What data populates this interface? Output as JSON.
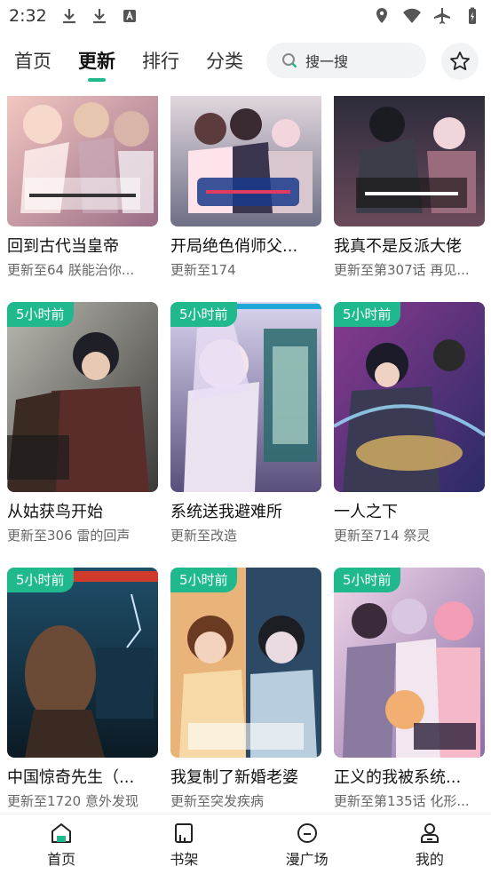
{
  "status_bar": {
    "time": "2:32"
  },
  "tabs": [
    {
      "label": "首页"
    },
    {
      "label": "更新"
    },
    {
      "label": "排行"
    },
    {
      "label": "分类"
    }
  ],
  "search": {
    "placeholder": "搜一搜"
  },
  "accent": "#1fb98d",
  "cards": [
    {
      "title": "回到古代当皇帝",
      "sub": "更新至64 朕能治你...",
      "badge": ""
    },
    {
      "title": "开局绝色俏师父...",
      "sub": "更新至174",
      "badge": ""
    },
    {
      "title": "我真不是反派大佬",
      "sub": "更新至第307话 再见...",
      "badge": ""
    },
    {
      "title": "从姑获鸟开始",
      "sub": "更新至306 雷的回声",
      "badge": "5小时前"
    },
    {
      "title": "系统送我避难所",
      "sub": "更新至改造",
      "badge": "5小时前"
    },
    {
      "title": "一人之下",
      "sub": "更新至714 祭灵",
      "badge": "5小时前"
    },
    {
      "title": "中国惊奇先生（...",
      "sub": "更新至1720 意外发现",
      "badge": "5小时前"
    },
    {
      "title": "我复制了新婚老婆",
      "sub": "更新至突发疾病",
      "badge": "5小时前"
    },
    {
      "title": "正义的我被系统...",
      "sub": "更新至第135话 化形...",
      "badge": "5小时前"
    }
  ],
  "bottom_nav": [
    {
      "label": "首页",
      "icon": "home-icon"
    },
    {
      "label": "书架",
      "icon": "bookshelf-icon"
    },
    {
      "label": "漫广场",
      "icon": "square-icon"
    },
    {
      "label": "我的",
      "icon": "profile-icon"
    }
  ]
}
